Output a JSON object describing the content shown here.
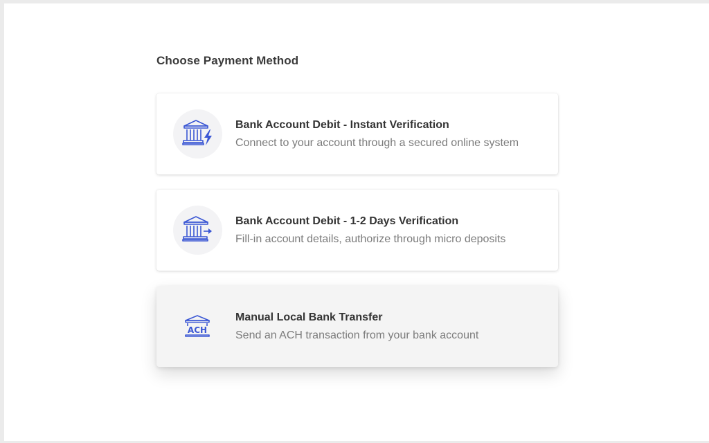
{
  "page": {
    "title": "Choose Payment Method"
  },
  "options": [
    {
      "title": "Bank Account Debit - Instant Verification",
      "description": "Connect to your account through a secured online system",
      "icon": "bank-lightning-icon",
      "selected": false
    },
    {
      "title": "Bank Account Debit - 1-2 Days Verification",
      "description": "Fill-in account details, authorize through micro deposits",
      "icon": "bank-arrow-icon",
      "selected": false
    },
    {
      "title": "Manual Local Bank Transfer",
      "description": "Send an ACH transaction from your bank account",
      "icon": "bank-ach-icon",
      "icon_text": "ACH",
      "selected": true
    }
  ],
  "colors": {
    "accent": "#3a56d4",
    "title_text": "#333333",
    "description_text": "#7b7b7b",
    "selected_background": "#f4f4f4"
  }
}
